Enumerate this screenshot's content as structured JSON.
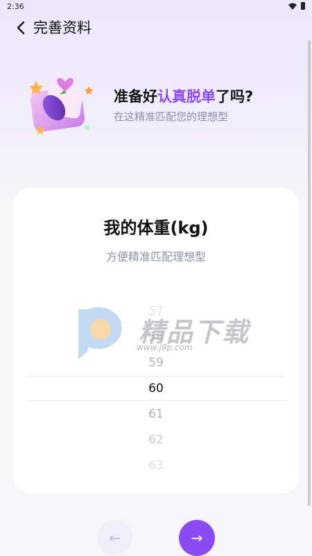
{
  "status_bar": {
    "time": "2:36"
  },
  "nav": {
    "title": "完善资料"
  },
  "promo": {
    "title_prefix": "准备好",
    "title_highlight": "认真脱单",
    "title_suffix": "了吗?",
    "subtitle": "在这精准匹配您的理想型"
  },
  "card": {
    "title": "我的体重(kg)",
    "subtitle": "方便精准匹配理想型"
  },
  "picker": {
    "selected": "60",
    "items": [
      "57",
      "58",
      "59",
      "60",
      "61",
      "62",
      "63"
    ]
  },
  "watermark": {
    "text": "精品下载",
    "url": "www.j9p.com"
  },
  "buttons": {
    "prev_label": "←",
    "next_label": "→"
  },
  "colors": {
    "accent": "#8A4BF2",
    "muted": "#8C90A0"
  }
}
